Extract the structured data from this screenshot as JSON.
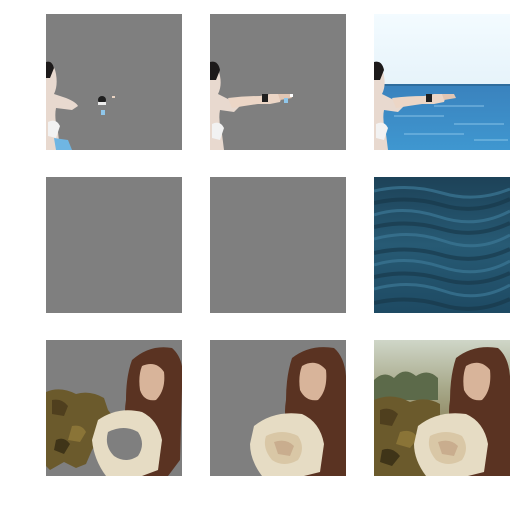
{
  "grid": {
    "rows": [
      {
        "panels": [
          {
            "kind": "masked-segment",
            "content": "beach-arm-partial-icon"
          },
          {
            "kind": "masked-segment",
            "content": "beach-arm-full-icon"
          },
          {
            "kind": "original-image",
            "content": "beach-sea-person-icon"
          }
        ]
      },
      {
        "panels": [
          {
            "kind": "masked-segment",
            "content": "empty-mask-icon"
          },
          {
            "kind": "masked-segment",
            "content": "empty-mask-icon"
          },
          {
            "kind": "original-image",
            "content": "ocean-waves-icon"
          }
        ]
      },
      {
        "panels": [
          {
            "kind": "masked-segment",
            "content": "woman-forest-partial-icon"
          },
          {
            "kind": "masked-segment",
            "content": "woman-cutout-icon"
          },
          {
            "kind": "original-image",
            "content": "woman-forest-icon"
          }
        ]
      }
    ]
  },
  "colors": {
    "mask_gray": "#7f7f7f",
    "sky": "#eef7fb",
    "sea": "#3f86bf",
    "deep_sea": "#214a60",
    "hair": "#5a3322",
    "skin": "#d8b49a",
    "garment": "#e6dcc4",
    "foliage": "#6b5a2c"
  }
}
